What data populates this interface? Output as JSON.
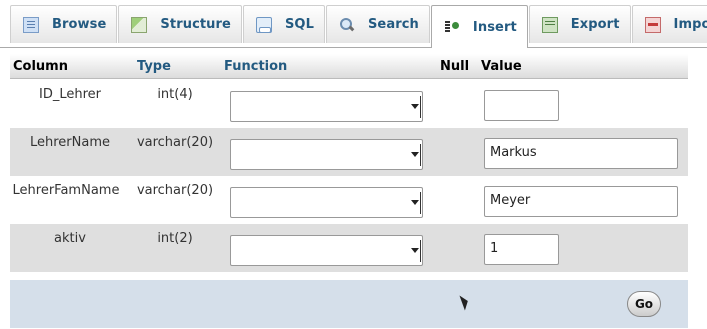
{
  "tabs": [
    {
      "label": "Browse",
      "icon": "browse-icon"
    },
    {
      "label": "Structure",
      "icon": "structure-icon"
    },
    {
      "label": "SQL",
      "icon": "sql-icon"
    },
    {
      "label": "Search",
      "icon": "search-icon"
    },
    {
      "label": "Insert",
      "icon": "insert-icon",
      "active": true
    },
    {
      "label": "Export",
      "icon": "export-icon"
    },
    {
      "label": "Import",
      "icon": "import-icon"
    }
  ],
  "table": {
    "headers": {
      "column": "Column",
      "type": "Type",
      "function": "Function",
      "null": "Null",
      "value": "Value"
    },
    "rows": [
      {
        "column": "ID_Lehrer",
        "type": "int(4)",
        "function": "",
        "value": ""
      },
      {
        "column": "LehrerName",
        "type": "varchar(20)",
        "function": "",
        "value": "Markus"
      },
      {
        "column": "LehrerFamName",
        "type": "varchar(20)",
        "function": "",
        "value": "Meyer"
      },
      {
        "column": "aktiv",
        "type": "int(2)",
        "function": "",
        "value": "1"
      }
    ]
  },
  "footer": {
    "go_label": "Go"
  },
  "colors": {
    "link": "#235a81",
    "row_alt": "#dfdfdf",
    "footer": "#d5dfea"
  }
}
